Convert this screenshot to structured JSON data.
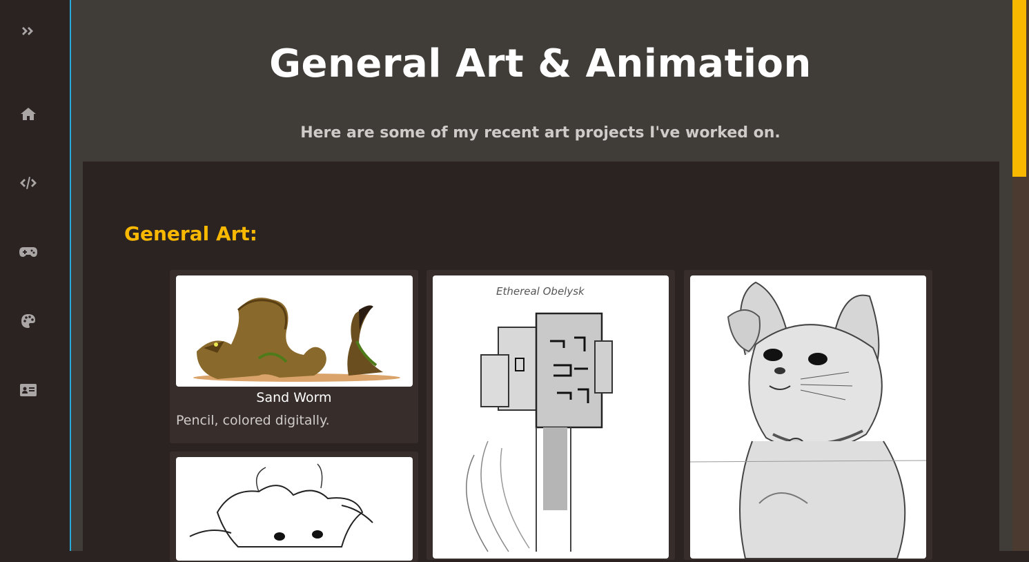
{
  "sidebar": {
    "items": [
      {
        "name": "expand",
        "icon": "double-chevron-right-icon"
      },
      {
        "name": "home",
        "icon": "home-icon"
      },
      {
        "name": "code",
        "icon": "code-icon"
      },
      {
        "name": "games",
        "icon": "gamepad-icon"
      },
      {
        "name": "art",
        "icon": "palette-icon"
      },
      {
        "name": "contact",
        "icon": "id-card-icon"
      }
    ]
  },
  "header": {
    "title": "General Art & Animation",
    "subtitle": "Here are some of my recent art projects I've worked on."
  },
  "section": {
    "heading": "General Art:"
  },
  "cards": [
    {
      "title": "Sand Worm",
      "description": "Pencil, colored digitally.",
      "image": "sand-worm-drawing"
    },
    {
      "title": "",
      "description": "",
      "image": "horned-creature-sketch"
    },
    {
      "title": "",
      "description": "",
      "image": "ethereal-obelysk-sketch",
      "caption": "Ethereal Obelysk"
    },
    {
      "title": "",
      "description": "",
      "image": "lucky-cat-sketch"
    }
  ],
  "colors": {
    "accent": "#f8b800",
    "sidebar_border": "#29a8dc",
    "header_bg": "#403c38",
    "panel_bg": "#2b2322",
    "card_bg": "#372d2b"
  }
}
